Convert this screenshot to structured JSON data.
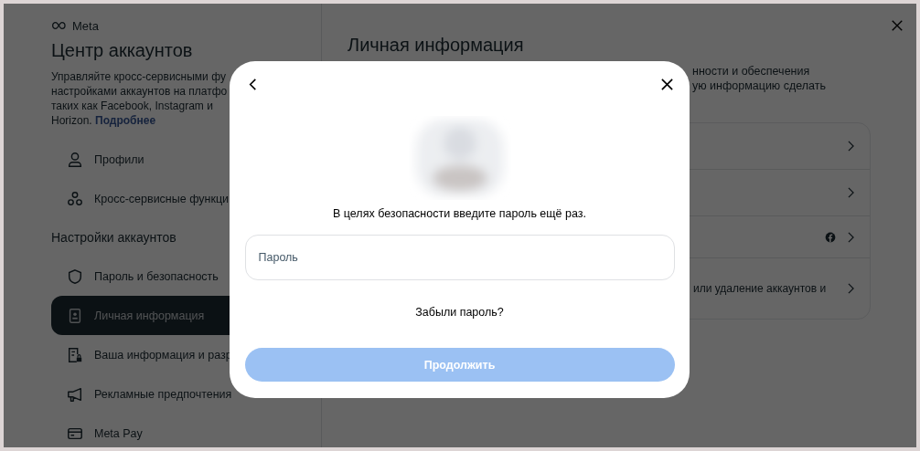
{
  "brand": "Meta",
  "sidebar": {
    "title": "Центр аккаунтов",
    "description_lines": [
      "Управляйте кросс-сервисными фу",
      "настройками аккаунтов на платфо",
      "таких как Facebook, Instagram и",
      "Horizon."
    ],
    "description_link": "Подробнее",
    "top_items": [
      {
        "kind": "person",
        "label": "Профили",
        "selected": false
      },
      {
        "kind": "nodes",
        "label": "Кросс-сервисные функци",
        "selected": false
      }
    ],
    "settings": {
      "heading": "Настройки аккаунтов",
      "items": [
        {
          "kind": "shield",
          "label": "Пароль и безопасность",
          "selected": false
        },
        {
          "kind": "badge",
          "label": "Личная информация",
          "selected": true
        },
        {
          "kind": "doc",
          "label": "Ваша информация и разр",
          "selected": false
        },
        {
          "kind": "megaphone",
          "label": "Рекламные предпочтения",
          "selected": false
        },
        {
          "kind": "card",
          "label": "Meta Pay",
          "selected": false
        }
      ]
    }
  },
  "main": {
    "title": "Личная информация",
    "description_lines": [
      "нности и обеспечения",
      "ую информацию сделать"
    ],
    "rows": [
      {
        "kind": "plain"
      },
      {
        "kind": "plain"
      },
      {
        "kind": "facebook"
      },
      {
        "kind": "text",
        "text": "или удаление аккаунтов и"
      }
    ]
  },
  "modal": {
    "prompt": "В целях безопасности введите пароль ещё раз.",
    "password": {
      "placeholder": "Пароль"
    },
    "forgot_link": "Забыли пароль?",
    "continue_button": {
      "label": "Продолжить",
      "disabled": true
    }
  }
}
